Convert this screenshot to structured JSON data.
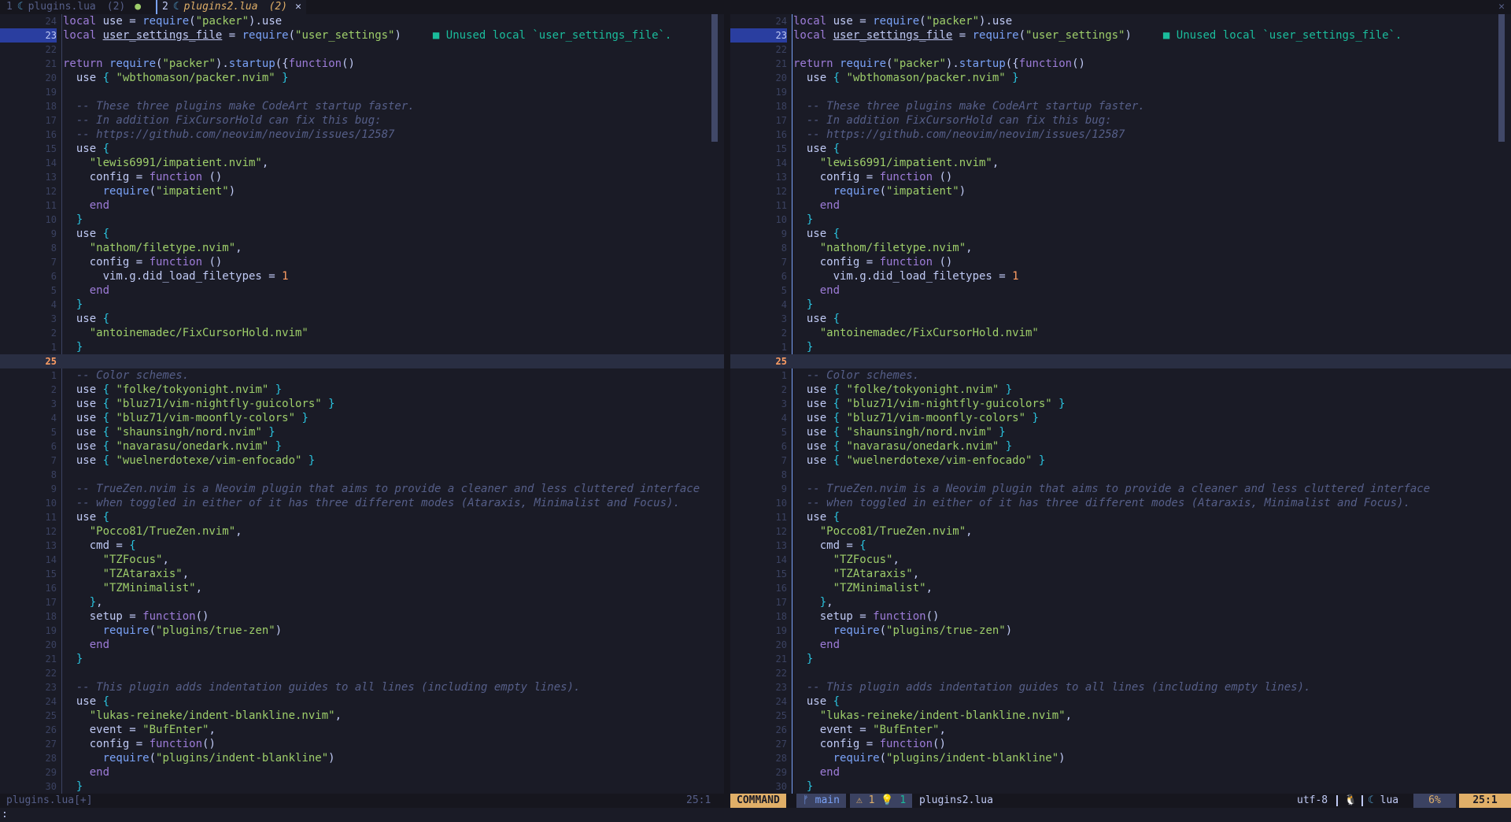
{
  "tabline": {
    "tabs": [
      {
        "index": "1",
        "icon": "lua-icon",
        "name": "plugins.lua",
        "count": "(2)",
        "modified": "●",
        "active": false
      },
      {
        "index": "2",
        "icon": "lua-icon",
        "name": "plugins2.lua",
        "count": "(2)",
        "close": "✕",
        "active": true
      }
    ],
    "end_close": "✕"
  },
  "panes": [
    {
      "id": "left",
      "scroll": "35%"
    },
    {
      "id": "right",
      "scroll": "35%"
    }
  ],
  "lines": [
    {
      "ln": "24",
      "code": [
        [
          "kw",
          "local "
        ],
        [
          "pl",
          "use = "
        ],
        [
          "fn",
          "require"
        ],
        [
          "pl",
          "("
        ],
        [
          "st",
          "\"packer\""
        ],
        [
          "pl",
          ").use"
        ]
      ]
    },
    {
      "ln": "23",
      "hl": true,
      "code": [
        [
          "kw",
          "local "
        ],
        [
          "ul",
          "user_settings_file"
        ],
        [
          "pl",
          " = "
        ],
        [
          "fn",
          "require"
        ],
        [
          "pl",
          "("
        ],
        [
          "st",
          "\"user_settings\""
        ],
        [
          "pl",
          ")"
        ]
      ],
      "diag": "■ Unused local `user_settings_file`."
    },
    {
      "ln": "22",
      "code": []
    },
    {
      "ln": "21",
      "code": [
        [
          "kw",
          "return "
        ],
        [
          "fn",
          "require"
        ],
        [
          "pl",
          "("
        ],
        [
          "st",
          "\"packer\""
        ],
        [
          "pl",
          ")."
        ],
        [
          "fn",
          "startup"
        ],
        [
          "pl",
          "({"
        ],
        [
          "kw",
          "function"
        ],
        [
          "pl",
          "()"
        ]
      ]
    },
    {
      "ln": "20",
      "code": [
        [
          "pl",
          "  use "
        ],
        [
          "pn",
          "{ "
        ],
        [
          "st",
          "\"wbthomason/packer.nvim\""
        ],
        [
          "pn",
          " }"
        ]
      ]
    },
    {
      "ln": "19",
      "code": []
    },
    {
      "ln": "18",
      "code": [
        [
          "cm",
          "  -- These three plugins make CodeArt startup faster."
        ]
      ]
    },
    {
      "ln": "17",
      "code": [
        [
          "cm",
          "  -- In addition FixCursorHold can fix this bug:"
        ]
      ]
    },
    {
      "ln": "16",
      "code": [
        [
          "cm",
          "  -- https://github.com/neovim/neovim/issues/12587"
        ]
      ]
    },
    {
      "ln": "15",
      "code": [
        [
          "pl",
          "  use "
        ],
        [
          "pn",
          "{"
        ]
      ]
    },
    {
      "ln": "14",
      "code": [
        [
          "st",
          "    \"lewis6991/impatient.nvim\""
        ],
        [
          "pl",
          ","
        ]
      ]
    },
    {
      "ln": "13",
      "code": [
        [
          "pl",
          "    config = "
        ],
        [
          "kw",
          "function"
        ],
        [
          "pl",
          " ()"
        ]
      ]
    },
    {
      "ln": "12",
      "code": [
        [
          "fn",
          "      require"
        ],
        [
          "pl",
          "("
        ],
        [
          "st",
          "\"impatient\""
        ],
        [
          "pl",
          ")"
        ]
      ]
    },
    {
      "ln": "11",
      "code": [
        [
          "kw",
          "    end"
        ]
      ]
    },
    {
      "ln": "10",
      "code": [
        [
          "pn",
          "  }"
        ]
      ]
    },
    {
      "ln": "9",
      "code": [
        [
          "pl",
          "  use "
        ],
        [
          "pn",
          "{"
        ]
      ]
    },
    {
      "ln": "8",
      "code": [
        [
          "st",
          "    \"nathom/filetype.nvim\""
        ],
        [
          "pl",
          ","
        ]
      ]
    },
    {
      "ln": "7",
      "code": [
        [
          "pl",
          "    config = "
        ],
        [
          "kw",
          "function"
        ],
        [
          "pl",
          " ()"
        ]
      ]
    },
    {
      "ln": "6",
      "code": [
        [
          "pl",
          "      vim.g.did_load_filetypes = "
        ],
        [
          "nm",
          "1"
        ]
      ]
    },
    {
      "ln": "5",
      "code": [
        [
          "kw",
          "    end"
        ]
      ]
    },
    {
      "ln": "4",
      "code": [
        [
          "pn",
          "  }"
        ]
      ]
    },
    {
      "ln": "3",
      "code": [
        [
          "pl",
          "  use "
        ],
        [
          "pn",
          "{"
        ]
      ]
    },
    {
      "ln": "2",
      "code": [
        [
          "st",
          "    \"antoinemadec/FixCursorHold.nvim\""
        ]
      ]
    },
    {
      "ln": "1",
      "code": [
        [
          "pn",
          "  }"
        ]
      ]
    },
    {
      "ln": "25",
      "cur": true,
      "code": []
    },
    {
      "ln": "1",
      "code": [
        [
          "cm",
          "  -- Color schemes."
        ]
      ]
    },
    {
      "ln": "2",
      "code": [
        [
          "pl",
          "  use "
        ],
        [
          "pn",
          "{ "
        ],
        [
          "st",
          "\"folke/tokyonight.nvim\""
        ],
        [
          "pn",
          " }"
        ]
      ]
    },
    {
      "ln": "3",
      "code": [
        [
          "pl",
          "  use "
        ],
        [
          "pn",
          "{ "
        ],
        [
          "st",
          "\"bluz71/vim-nightfly-guicolors\""
        ],
        [
          "pn",
          " }"
        ]
      ]
    },
    {
      "ln": "4",
      "code": [
        [
          "pl",
          "  use "
        ],
        [
          "pn",
          "{ "
        ],
        [
          "st",
          "\"bluz71/vim-moonfly-colors\""
        ],
        [
          "pn",
          " }"
        ]
      ]
    },
    {
      "ln": "5",
      "code": [
        [
          "pl",
          "  use "
        ],
        [
          "pn",
          "{ "
        ],
        [
          "st",
          "\"shaunsingh/nord.nvim\""
        ],
        [
          "pn",
          " }"
        ]
      ]
    },
    {
      "ln": "6",
      "code": [
        [
          "pl",
          "  use "
        ],
        [
          "pn",
          "{ "
        ],
        [
          "st",
          "\"navarasu/onedark.nvim\""
        ],
        [
          "pn",
          " }"
        ]
      ]
    },
    {
      "ln": "7",
      "code": [
        [
          "pl",
          "  use "
        ],
        [
          "pn",
          "{ "
        ],
        [
          "st",
          "\"wuelnerdotexe/vim-enfocado\""
        ],
        [
          "pn",
          " }"
        ]
      ]
    },
    {
      "ln": "8",
      "code": []
    },
    {
      "ln": "9",
      "code": [
        [
          "cm",
          "  -- TrueZen.nvim is a Neovim plugin that aims to provide a cleaner and less cluttered interface"
        ]
      ]
    },
    {
      "ln": "10",
      "code": [
        [
          "cm",
          "  -- when toggled in either of it has three different modes (Ataraxis, Minimalist and Focus)."
        ]
      ]
    },
    {
      "ln": "11",
      "code": [
        [
          "pl",
          "  use "
        ],
        [
          "pn",
          "{"
        ]
      ]
    },
    {
      "ln": "12",
      "code": [
        [
          "st",
          "    \"Pocco81/TrueZen.nvim\""
        ],
        [
          "pl",
          ","
        ]
      ]
    },
    {
      "ln": "13",
      "code": [
        [
          "pl",
          "    cmd = "
        ],
        [
          "pn",
          "{"
        ]
      ]
    },
    {
      "ln": "14",
      "code": [
        [
          "st",
          "      \"TZFocus\""
        ],
        [
          "pl",
          ","
        ]
      ]
    },
    {
      "ln": "15",
      "code": [
        [
          "st",
          "      \"TZAtaraxis\""
        ],
        [
          "pl",
          ","
        ]
      ]
    },
    {
      "ln": "16",
      "code": [
        [
          "st",
          "      \"TZMinimalist\""
        ],
        [
          "pl",
          ","
        ]
      ]
    },
    {
      "ln": "17",
      "code": [
        [
          "pn",
          "    }"
        ],
        [
          "pl",
          ","
        ]
      ]
    },
    {
      "ln": "18",
      "code": [
        [
          "pl",
          "    setup = "
        ],
        [
          "kw",
          "function"
        ],
        [
          "pl",
          "()"
        ]
      ]
    },
    {
      "ln": "19",
      "code": [
        [
          "fn",
          "      require"
        ],
        [
          "pl",
          "("
        ],
        [
          "st",
          "\"plugins/true-zen\""
        ],
        [
          "pl",
          ")"
        ]
      ]
    },
    {
      "ln": "20",
      "code": [
        [
          "kw",
          "    end"
        ]
      ]
    },
    {
      "ln": "21",
      "code": [
        [
          "pn",
          "  }"
        ]
      ]
    },
    {
      "ln": "22",
      "code": []
    },
    {
      "ln": "23",
      "code": [
        [
          "cm",
          "  -- This plugin adds indentation guides to all lines (including empty lines)."
        ]
      ]
    },
    {
      "ln": "24",
      "code": [
        [
          "pl",
          "  use "
        ],
        [
          "pn",
          "{"
        ]
      ]
    },
    {
      "ln": "25",
      "code": [
        [
          "st",
          "    \"lukas-reineke/indent-blankline.nvim\""
        ],
        [
          "pl",
          ","
        ]
      ]
    },
    {
      "ln": "26",
      "code": [
        [
          "pl",
          "    event = "
        ],
        [
          "st",
          "\"BufEnter\""
        ],
        [
          "pl",
          ","
        ]
      ]
    },
    {
      "ln": "27",
      "code": [
        [
          "pl",
          "    config = "
        ],
        [
          "kw",
          "function"
        ],
        [
          "pl",
          "()"
        ]
      ]
    },
    {
      "ln": "28",
      "code": [
        [
          "fn",
          "      require"
        ],
        [
          "pl",
          "("
        ],
        [
          "st",
          "\"plugins/indent-blankline\""
        ],
        [
          "pl",
          ")"
        ]
      ]
    },
    {
      "ln": "29",
      "code": [
        [
          "kw",
          "    end"
        ]
      ]
    },
    {
      "ln": "30",
      "code": [
        [
          "pn",
          "  }"
        ]
      ]
    }
  ],
  "statusline": {
    "left_file": "plugins.lua[+]",
    "left_pos": "25:1",
    "mode": "COMMAND",
    "branch": "ᚠ main",
    "warnings": "⚠ 1",
    "hints": "💡 1",
    "file": "plugins2.lua",
    "encoding": "utf-8",
    "os_icon": "🐧",
    "filetype_icon": "lua-icon",
    "filetype": "lua",
    "percent": "6%",
    "cursor": "25:1"
  },
  "cmdline": ":",
  "colors": {
    "bg": "#1a1b26",
    "mode": "#e0af68",
    "string": "#9ece6a",
    "keyword": "#9d7cd8",
    "function": "#7aa2f7",
    "comment": "#565f89"
  }
}
